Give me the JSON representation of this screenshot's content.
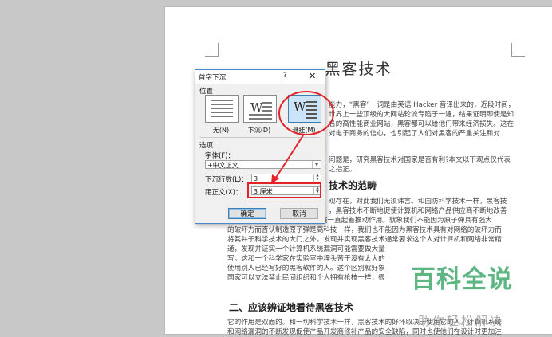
{
  "document": {
    "title": "黑客技术",
    "paragraph1": [
      "能力，“黑客”一词是由英语 Hacker 音译出来的，近段时间，",
      "世界上一些顶级的大网站轮流专陷于一遍，结果证明即使是知",
      "名的高性能商业网站，黑客都可以给他们带来经济损失。这在",
      "对电子商务的信心，也引起了人们对黑客的严重关注和对"
    ],
    "paragraph2": [
      "问题是，研究黑客技术对国家是否有利?本文以下观点仅代表",
      "之指正。"
    ],
    "heading1": "技术的范畴",
    "paragraph3": [
      "观存在，对此我们无须讳言。和国防科学技术一样，黑客技",
      "，黑客技术不断地促使计算机和网络产品供应商不断地改善",
      "的产品，对整个 Internet 的发展一直起着推动作用。就象我们不能因为原子弹具有强大",
      "的破坏力而否认制造原子弹是高科技一样，我们也不能因为黑客技术具有对网络的破坏力而",
      "将其并于科学技术的大门之外。发现并实现黑客技术通常要求这个人对计算机和网络非常精",
      "通，发现并证实一个计算机系统漏洞可能需要做大量",
      "写。这和一个科学家在实验室中埋头苦干没有太大的",
      "使用别人已经写好的黑客软件的人。这个区别就好象",
      "国家可以立法禁止民间组织和个人拥有枪枝一样，很"
    ],
    "heading2": "二、应该辨证地看待黑客技术",
    "paragraph4": [
      "它的作用是双面的。和一切科学技术一样，黑客技术的好坏取决于使用它的人。计算机系统",
      "和网络漏洞的不断发现促使产品开发商修补产品的安全缺陷，同时也使他们在设计时更加注"
    ]
  },
  "dialog": {
    "title": "首字下沉",
    "help": "?",
    "close": "✕",
    "position_label": "位置",
    "options": [
      {
        "label": "无(N)",
        "selected": false
      },
      {
        "label": "下沉(D)",
        "selected": false
      },
      {
        "label": "悬挂(M)",
        "selected": true
      }
    ],
    "option_glyph": "W",
    "options_label": "选项",
    "font_label": "字体(F)：",
    "font_value": "+中文正文",
    "lines_label": "下沉行数(L)：",
    "lines_value": "3",
    "distance_label": "距正文(X)：",
    "distance_value": "3 厘米",
    "ok_label": "确定",
    "cancel_label": "取消"
  },
  "watermark": {
    "brand": "百科全说",
    "tagline": "助你轻松解决"
  },
  "colors": {
    "annotation": "#e2242a",
    "dialog_border": "#4a86c8",
    "selected_option": "#cce4f7",
    "watermark": "#4caf76"
  }
}
